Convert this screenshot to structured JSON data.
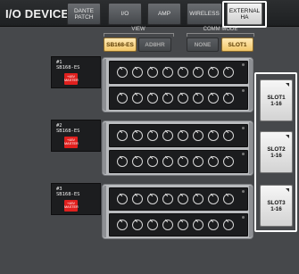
{
  "header": {
    "title": "I/O DEVICE",
    "tabs": [
      {
        "label": "DANTE PATCH",
        "line1": "DANTE",
        "line2": "PATCH"
      },
      {
        "label": "I/O"
      },
      {
        "label": "AMP"
      },
      {
        "label": "WIRELESS"
      },
      {
        "label": "EXTERNAL HA",
        "line1": "EXTERNAL",
        "line2": "HA",
        "active": true
      }
    ]
  },
  "view": {
    "label": "VIEW",
    "options": [
      "SB168-ES",
      "AD8HR"
    ],
    "selected": "SB168-ES"
  },
  "comm_mode": {
    "label": "COMM MODE",
    "options": [
      "NONE",
      "SLOT1"
    ],
    "selected": "SLOT1"
  },
  "devices": [
    {
      "id": "#1",
      "model": "SB168-ES",
      "badge_line1": "+48V",
      "badge_line2": "MASTER"
    },
    {
      "id": "#2",
      "model": "SB168-ES",
      "badge_line1": "+48V",
      "badge_line2": "MASTER"
    },
    {
      "id": "#3",
      "model": "SB168-ES",
      "badge_line1": "+48V",
      "badge_line2": "MASTER"
    }
  ],
  "slots": [
    {
      "line1": "SLOT1",
      "line2": "1-16"
    },
    {
      "line1": "SLOT2",
      "line2": "1-16"
    },
    {
      "line1": "SLOT3",
      "line2": "1-16"
    }
  ],
  "colors": {
    "active_tab": "#e6e6e6",
    "selected_button": "#f2c76a",
    "badge_red": "#e0201e",
    "highlight_box": "#ffffff"
  },
  "icons": {
    "knob": "knob-icon",
    "corner": "corner-triangle-icon"
  }
}
